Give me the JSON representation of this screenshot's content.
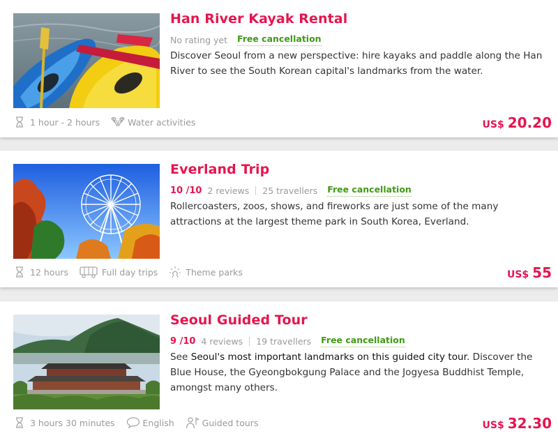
{
  "colors": {
    "accent": "#e5154f",
    "free_cancellation": "#3f9a14",
    "muted_text": "#9a9a9a",
    "body_text": "#333333"
  },
  "activities": [
    {
      "title": "Han River Kayak Rental",
      "rating_text": "No rating yet",
      "free_cancellation": "Free cancellation",
      "description": "Discover Seoul from a new perspective: hire kayaks and paddle along the Han River to see the South Korean capital's landmarks from the water.",
      "features": [
        {
          "icon": "hourglass-icon",
          "label": "1 hour - 2 hours"
        },
        {
          "icon": "paddles-icon",
          "label": "Water activities"
        }
      ],
      "price": {
        "currency": "US$",
        "amount": "20.20"
      }
    },
    {
      "title": "Everland Trip",
      "rating": "10 /10",
      "reviews": "2 reviews",
      "travellers": "25 travellers",
      "free_cancellation": "Free cancellation",
      "description": "Rollercoasters, zoos, shows, and fireworks are just some of the many attractions at the largest theme park in South Korea, Everland.",
      "features": [
        {
          "icon": "hourglass-icon",
          "label": "12 hours"
        },
        {
          "icon": "bus-icon",
          "label": "Full day trips"
        },
        {
          "icon": "sun-icon",
          "label": "Theme parks"
        }
      ],
      "price": {
        "currency": "US$",
        "amount": "55"
      }
    },
    {
      "title": "Seoul Guided Tour",
      "rating": "9 /10",
      "reviews": "4 reviews",
      "travellers": "19 travellers",
      "free_cancellation": "Free cancellation",
      "description_prefix": "See ",
      "description_emphasis": "Seoul's most important landmarks on this guided city tour",
      "description_suffix": ". Discover the Blue House, the Gyeongbokgung Palace and the Jogyesa Buddhist Temple, amongst many others.",
      "features": [
        {
          "icon": "hourglass-icon",
          "label": "3 hours 30 minutes"
        },
        {
          "icon": "speech-bubble-icon",
          "label": "English"
        },
        {
          "icon": "guide-icon",
          "label": "Guided tours"
        }
      ],
      "price": {
        "currency": "US$",
        "amount": "32.30"
      }
    }
  ]
}
